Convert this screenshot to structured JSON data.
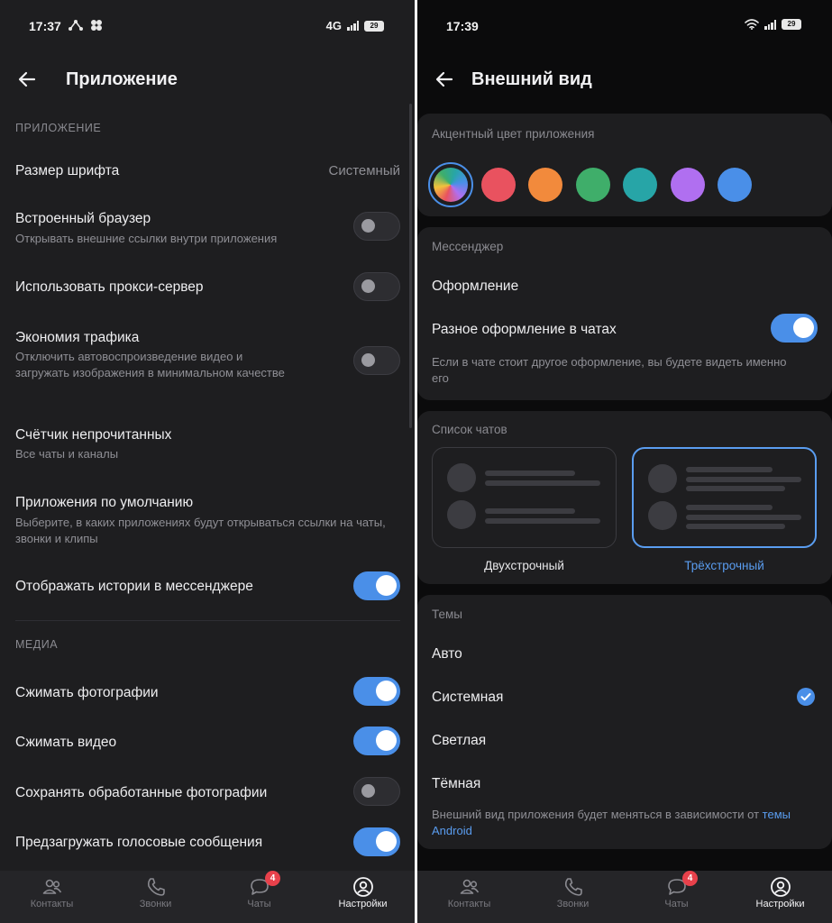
{
  "left": {
    "status": {
      "time": "17:37",
      "network": "4G",
      "battery": "29"
    },
    "title": "Приложение",
    "section_app": "ПРИЛОЖЕНИЕ",
    "font_size": {
      "title": "Размер шрифта",
      "value": "Системный"
    },
    "browser": {
      "title": "Встроенный браузер",
      "subtitle": "Открывать внешние ссылки внутри приложения",
      "enabled": false
    },
    "proxy": {
      "title": "Использовать прокси-сервер",
      "enabled": false
    },
    "traffic": {
      "title": "Экономия трафика",
      "subtitle": "Отключить автовоспроизведение видео и загружать изображения в минимальном качестве",
      "enabled": false
    },
    "unread": {
      "title": "Счётчик непрочитанных",
      "subtitle": "Все чаты и каналы"
    },
    "default_apps": {
      "title": "Приложения по умолчанию",
      "subtitle": "Выберите, в каких приложениях будут открываться ссылки на чаты, звонки и клипы"
    },
    "stories": {
      "title": "Отображать истории в мессенджере",
      "enabled": true
    },
    "section_media": "МЕДИА",
    "compress_photos": {
      "title": "Сжимать фотографии",
      "enabled": true
    },
    "compress_video": {
      "title": "Сжимать видео",
      "enabled": true
    },
    "save_processed": {
      "title": "Сохранять обработанные фотографии",
      "enabled": false
    },
    "preload_voice": {
      "title": "Предзагружать голосовые сообщения",
      "enabled": true
    }
  },
  "right": {
    "status": {
      "time": "17:39",
      "battery": "29"
    },
    "title": "Внешний вид",
    "accent": {
      "label": "Акцентный цвет приложения",
      "colors": [
        "gradient",
        "#e9525f",
        "#f28a3c",
        "#3fae6a",
        "#27a5a7",
        "#b06ff0",
        "#4a8fe8"
      ],
      "selected": 0
    },
    "messenger": {
      "label": "Мессенджер",
      "design": "Оформление",
      "per_chat": {
        "title": "Разное оформление в чатах",
        "enabled": true
      },
      "per_chat_note": "Если в чате стоит другое оформление, вы будете видеть именно его"
    },
    "chat_list": {
      "label": "Список чатов",
      "options": [
        "Двухстрочный",
        "Трёхстрочный"
      ],
      "selected": 1
    },
    "themes": {
      "label": "Темы",
      "options": [
        "Авто",
        "Системная",
        "Светлая",
        "Тёмная"
      ],
      "selected": 1,
      "note_prefix": "Внешний вид приложения будет меняться в зависимости от",
      "note_link": "темы Android"
    }
  },
  "tabs": {
    "items": [
      "Контакты",
      "Звонки",
      "Чаты",
      "Настройки"
    ],
    "chat_badge": "4",
    "active": 3
  },
  "colors": {
    "accent": "#4a8fe8",
    "badge": "#e8414b",
    "background": "#1e1e20"
  }
}
